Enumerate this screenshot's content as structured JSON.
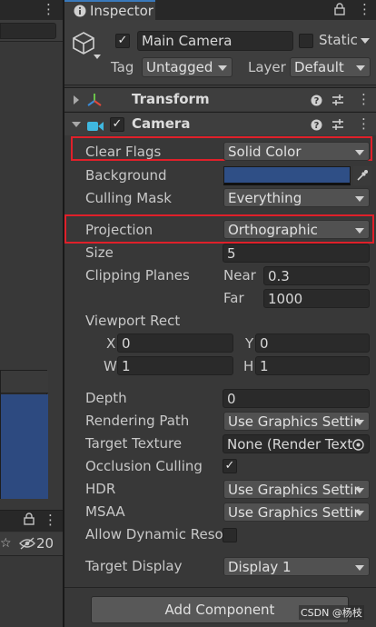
{
  "colors": {
    "accent": "#3a79bb",
    "highlight": "#e0202a",
    "background_swatch": "#2f4f86",
    "panel": "#383838",
    "field": "#2a2a2a",
    "left_preview": "#2d4a80"
  },
  "left": {
    "status_count": "20",
    "menu_icon": "kebab-icon",
    "lock_icon": "lock-icon",
    "eye_icon": "eye-slash-icon"
  },
  "inspector": {
    "tab_label": "Inspector",
    "tab_icon": "info-icon",
    "header": {
      "object_name": "Main Camera",
      "active": true,
      "static_label": "Static",
      "tag_label": "Tag",
      "tag_value": "Untagged",
      "layer_label": "Layer",
      "layer_value": "Default",
      "object_icon": "cube-icon"
    },
    "transform": {
      "title": "Transform",
      "icon": "transform-icon"
    },
    "camera": {
      "title": "Camera",
      "enabled": true,
      "icon": "camera-icon",
      "clear_flags_label": "Clear Flags",
      "clear_flags_value": "Solid Color",
      "background_label": "Background",
      "culling_mask_label": "Culling Mask",
      "culling_mask_value": "Everything",
      "projection_label": "Projection",
      "projection_value": "Orthographic",
      "size_label": "Size",
      "size_value": "5",
      "clipping_label": "Clipping Planes",
      "near_label": "Near",
      "near_value": "0.3",
      "far_label": "Far",
      "far_value": "1000",
      "viewport_label": "Viewport Rect",
      "x_label": "X",
      "x_value": "0",
      "y_label": "Y",
      "y_value": "0",
      "w_label": "W",
      "w_value": "1",
      "h_label": "H",
      "h_value": "1",
      "depth_label": "Depth",
      "depth_value": "0",
      "rendering_path_label": "Rendering Path",
      "rendering_path_value": "Use Graphics Settir",
      "target_texture_label": "Target Texture",
      "target_texture_value": "None (Render Text",
      "occlusion_label": "Occlusion Culling",
      "occlusion_checked": true,
      "hdr_label": "HDR",
      "hdr_value": "Use Graphics Settir",
      "msaa_label": "MSAA",
      "msaa_value": "Use Graphics Settir",
      "dynamic_res_label": "Allow Dynamic Reso",
      "target_display_label": "Target Display",
      "target_display_value": "Display 1"
    },
    "add_component_label": "Add Component",
    "watermark": "CSDN @杨枝"
  }
}
